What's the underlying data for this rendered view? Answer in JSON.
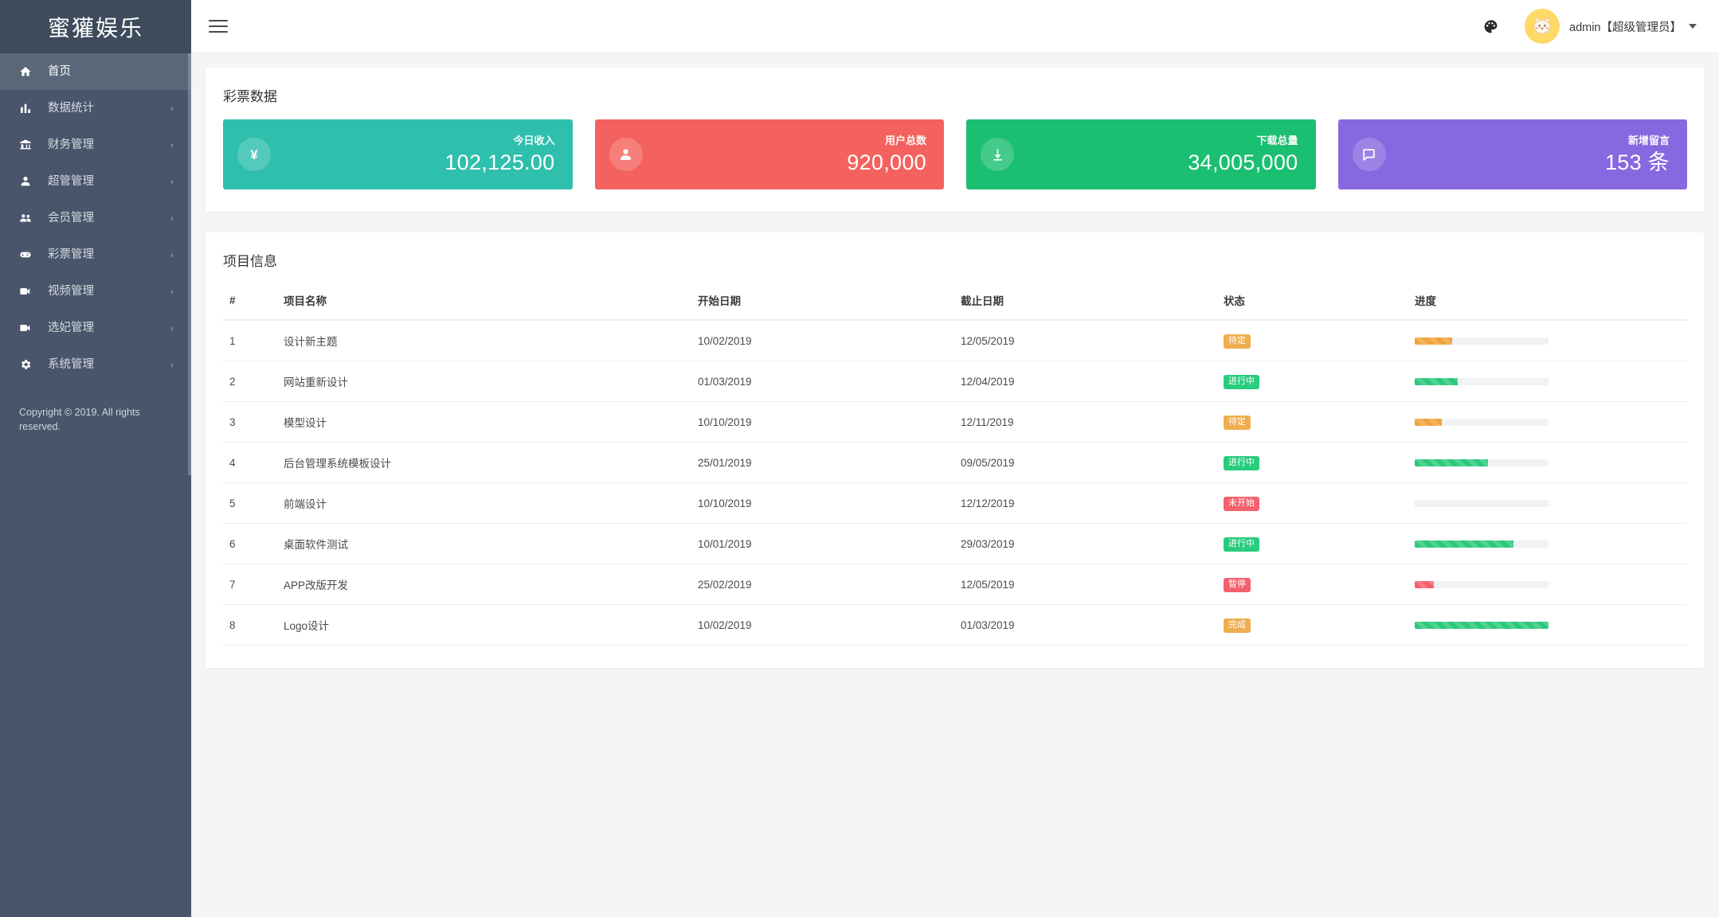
{
  "sidebar": {
    "brand": "蜜獾娱乐",
    "items": [
      {
        "label": "首页",
        "icon": "home-icon",
        "active": true,
        "caret": ""
      },
      {
        "label": "数据统计",
        "icon": "bar-chart-icon",
        "active": false,
        "caret": "›"
      },
      {
        "label": "财务管理",
        "icon": "bank-icon",
        "active": false,
        "caret": "›"
      },
      {
        "label": "超管管理",
        "icon": "person-icon",
        "active": false,
        "caret": "›"
      },
      {
        "label": "会员管理",
        "icon": "people-icon",
        "active": false,
        "caret": "›"
      },
      {
        "label": "彩票管理",
        "icon": "gamepad-icon",
        "active": false,
        "caret": "›"
      },
      {
        "label": "视频管理",
        "icon": "videocam-icon",
        "active": false,
        "caret": "›"
      },
      {
        "label": "选妃管理",
        "icon": "videocam-icon",
        "active": false,
        "caret": "›"
      },
      {
        "label": "系统管理",
        "icon": "gear-icon",
        "active": false,
        "caret": "›"
      }
    ],
    "copyright": "Copyright © 2019. All rights reserved."
  },
  "topbar": {
    "menu_toggle": "hamburger-icon",
    "theme_icon": "palette-icon",
    "avatar_icon": "cat-avatar-icon",
    "user_name": "admin【超级管理员】"
  },
  "stats_panel": {
    "title": "彩票数据",
    "cards": [
      {
        "label": "今日收入",
        "value": "102,125.00",
        "color": "#2fbfad",
        "icon": "yen-icon"
      },
      {
        "label": "用户总数",
        "value": "920,000",
        "color": "#f4625f",
        "icon": "person-icon"
      },
      {
        "label": "下载总量",
        "value": "34,005,000",
        "color": "#1bbf72",
        "icon": "download-icon"
      },
      {
        "label": "新增留言",
        "value": "153 条",
        "color": "#8868e0",
        "icon": "comment-icon"
      }
    ]
  },
  "projects_panel": {
    "title": "项目信息",
    "columns": [
      "#",
      "项目名称",
      "开始日期",
      "截止日期",
      "状态",
      "进度"
    ],
    "rows": [
      {
        "idx": "1",
        "name": "设计新主题",
        "start": "10/02/2019",
        "end": "12/05/2019",
        "status": "待定",
        "status_color": "#f0ad4e",
        "progress": 28,
        "progress_color": "#f0a33c"
      },
      {
        "idx": "2",
        "name": "网站重新设计",
        "start": "01/03/2019",
        "end": "12/04/2019",
        "status": "进行中",
        "status_color": "#28cc7d",
        "progress": 32,
        "progress_color": "#2cc97c"
      },
      {
        "idx": "3",
        "name": "模型设计",
        "start": "10/10/2019",
        "end": "12/11/2019",
        "status": "待定",
        "status_color": "#f0ad4e",
        "progress": 20,
        "progress_color": "#f0a33c"
      },
      {
        "idx": "4",
        "name": "后台管理系统模板设计",
        "start": "25/01/2019",
        "end": "09/05/2019",
        "status": "进行中",
        "status_color": "#28cc7d",
        "progress": 55,
        "progress_color": "#2cc97c"
      },
      {
        "idx": "5",
        "name": "前端设计",
        "start": "10/10/2019",
        "end": "12/12/2019",
        "status": "未开始",
        "status_color": "#f4606c",
        "progress": 0,
        "progress_color": "#2cc97c"
      },
      {
        "idx": "6",
        "name": "桌面软件测试",
        "start": "10/01/2019",
        "end": "29/03/2019",
        "status": "进行中",
        "status_color": "#28cc7d",
        "progress": 74,
        "progress_color": "#2cc97c"
      },
      {
        "idx": "7",
        "name": "APP改版开发",
        "start": "25/02/2019",
        "end": "12/05/2019",
        "status": "暂停",
        "status_color": "#f4606c",
        "progress": 14,
        "progress_color": "#f4606c"
      },
      {
        "idx": "8",
        "name": "Logo设计",
        "start": "10/02/2019",
        "end": "01/03/2019",
        "status": "完成",
        "status_color": "#f0ad4e",
        "progress": 100,
        "progress_color": "#2cc97c"
      }
    ]
  }
}
